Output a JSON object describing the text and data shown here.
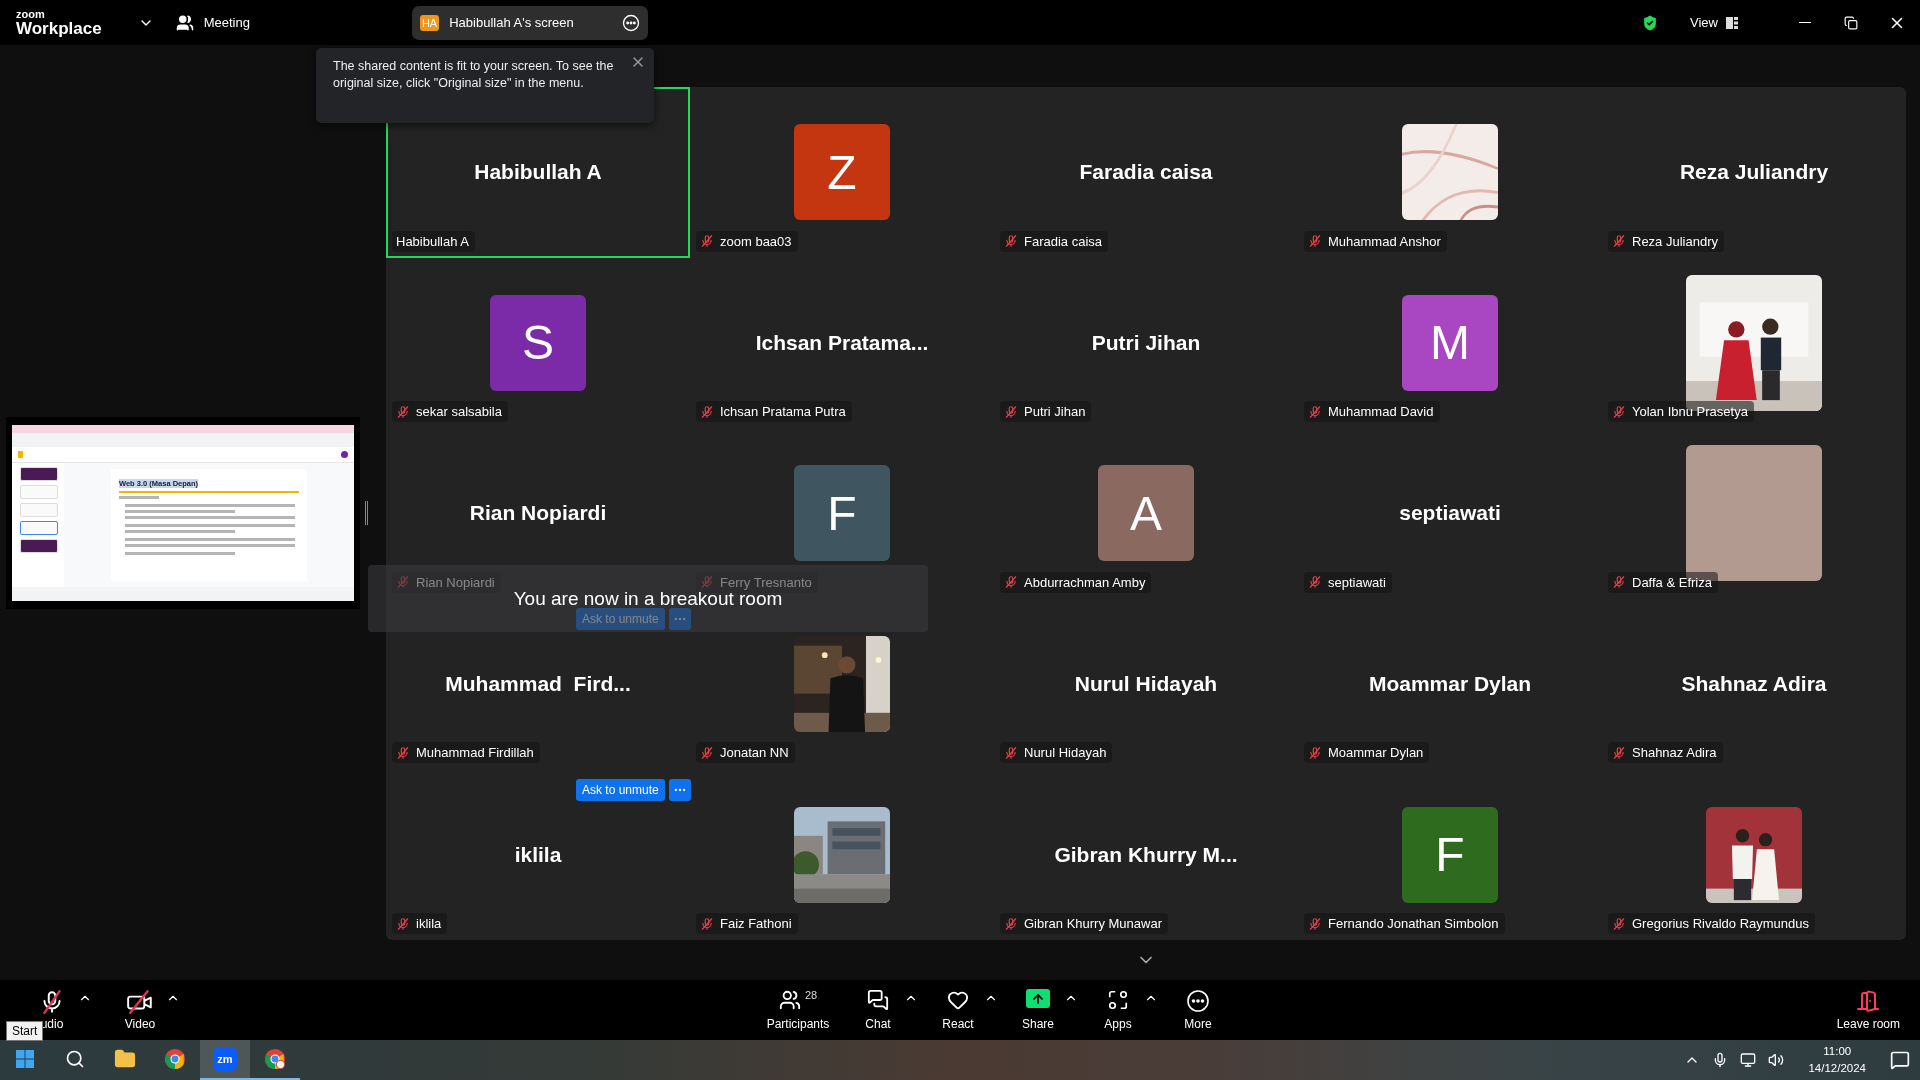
{
  "topbar": {
    "brand_small": "zoom",
    "brand": "Workplace",
    "meeting": "Meeting",
    "share_badge": "HA",
    "share_title": "Habibullah A's screen",
    "view": "View"
  },
  "tooltip": {
    "text": "The shared content is fit to your screen. To see the original size, click \"Original size\" in the menu."
  },
  "thumbnail": {
    "slide_title": "Web 3.0 (Masa Depan)"
  },
  "tiles": [
    {
      "kind": "name",
      "display": "Habibullah A",
      "label": "Habibullah A",
      "muted": false,
      "highlighted": true
    },
    {
      "kind": "avatar",
      "letter": "Z",
      "color": "#c4360f",
      "label": "zoom baa03",
      "muted": true,
      "highlighted": false
    },
    {
      "kind": "name",
      "display": "Faradia caisa",
      "label": "Faradia caisa",
      "muted": true,
      "highlighted": false
    },
    {
      "kind": "picture",
      "large": false,
      "label": "Muhammad Anshor",
      "muted": true,
      "highlighted": false
    },
    {
      "kind": "name",
      "display": "Reza Juliandry",
      "label": "Reza Juliandry",
      "muted": true,
      "highlighted": false
    },
    {
      "kind": "avatar",
      "letter": "S",
      "color": "#7b2aa8",
      "label": "sekar salsabila",
      "muted": true,
      "highlighted": false
    },
    {
      "kind": "name",
      "display": "Ichsan Pratama...",
      "label": "Ichsan Pratama Putra",
      "muted": true,
      "highlighted": false
    },
    {
      "kind": "name",
      "display": "Putri Jihan",
      "label": "Putri Jihan",
      "muted": true,
      "highlighted": false
    },
    {
      "kind": "avatar",
      "letter": "M",
      "color": "#a946c1",
      "label": "Muhammad David",
      "muted": true,
      "highlighted": false
    },
    {
      "kind": "picture",
      "large": true,
      "label": "Yolan Ibnu Prasetya",
      "muted": true,
      "highlighted": false
    },
    {
      "kind": "name",
      "display": "Rian Nopiardi",
      "label": "Rian Nopiardi",
      "muted": true,
      "highlighted": false,
      "unmute_button": "Ask to unmute"
    },
    {
      "kind": "avatar",
      "letter": "F",
      "color": "#3f5560",
      "label": "Ferry Tresnanto",
      "muted": true,
      "highlighted": false
    },
    {
      "kind": "avatar",
      "letter": "A",
      "color": "#8a6a60",
      "label": "Abdurrachman Amby",
      "muted": true,
      "highlighted": false
    },
    {
      "kind": "name",
      "display": "septiawati",
      "label": "septiawati",
      "muted": true,
      "highlighted": false
    },
    {
      "kind": "avatar",
      "color": "#b39a90",
      "large": true,
      "label": "Daffa & Efriza",
      "muted": true,
      "highlighted": false
    },
    {
      "kind": "name",
      "display": "Muhammad  Fird...",
      "label": "Muhammad Firdillah",
      "muted": true,
      "highlighted": false,
      "unmute_button": "Ask to unmute"
    },
    {
      "kind": "picture",
      "large": false,
      "label": "Jonatan NN",
      "muted": true,
      "highlighted": false
    },
    {
      "kind": "name",
      "display": "Nurul Hidayah",
      "label": "Nurul Hidayah",
      "muted": true,
      "highlighted": false
    },
    {
      "kind": "name",
      "display": "Moammar Dylan",
      "label": "Moammar Dylan",
      "muted": true,
      "highlighted": false
    },
    {
      "kind": "name",
      "display": "Shahnaz Adira",
      "label": "Shahnaz Adira",
      "muted": true,
      "highlighted": false
    },
    {
      "kind": "name",
      "display": "iklila",
      "label": "iklila",
      "muted": true,
      "highlighted": false
    },
    {
      "kind": "picture",
      "large": false,
      "label": "Faiz Fathoni",
      "muted": true,
      "highlighted": false
    },
    {
      "kind": "name",
      "display": "Gibran Khurry M...",
      "label": "Gibran Khurry Munawar",
      "muted": true,
      "highlighted": false
    },
    {
      "kind": "avatar",
      "letter": "F",
      "color": "#2e6b1e",
      "label": "Fernando Jonathan Simbolon",
      "muted": true,
      "highlighted": false
    },
    {
      "kind": "picture",
      "large": false,
      "label": "Gregorius Rivaldo Raymundus",
      "muted": true,
      "highlighted": false
    }
  ],
  "toast": "You are now in a breakout room",
  "toolbar": {
    "left": [
      {
        "kind": "audio",
        "label": "udio",
        "muted": true,
        "caret": true
      },
      {
        "kind": "video",
        "label": "Video",
        "muted": true,
        "caret": true
      }
    ],
    "center": [
      {
        "kind": "participants",
        "label": "Participants",
        "count": "28",
        "caret": false
      },
      {
        "kind": "chat",
        "label": "Chat",
        "caret": true
      },
      {
        "kind": "react",
        "label": "React",
        "caret": true
      },
      {
        "kind": "share",
        "label": "Share",
        "caret": true
      },
      {
        "kind": "apps",
        "label": "Apps",
        "caret": true
      },
      {
        "kind": "more",
        "label": "More",
        "caret": false
      }
    ],
    "leave": "Leave room"
  },
  "start_tooltip": "Start",
  "taskbar": {
    "apps": [
      {
        "kind": "start",
        "running": false,
        "selected": false
      },
      {
        "kind": "search",
        "running": false,
        "selected": false
      },
      {
        "kind": "explorer",
        "running": false,
        "selected": false
      },
      {
        "kind": "chrome",
        "running": false,
        "selected": false
      },
      {
        "kind": "zoom",
        "label": "zm",
        "running": true,
        "selected": true
      },
      {
        "kind": "chrome-profile",
        "running": true,
        "selected": false
      }
    ],
    "time": "11:00",
    "date": "14/12/2024"
  }
}
